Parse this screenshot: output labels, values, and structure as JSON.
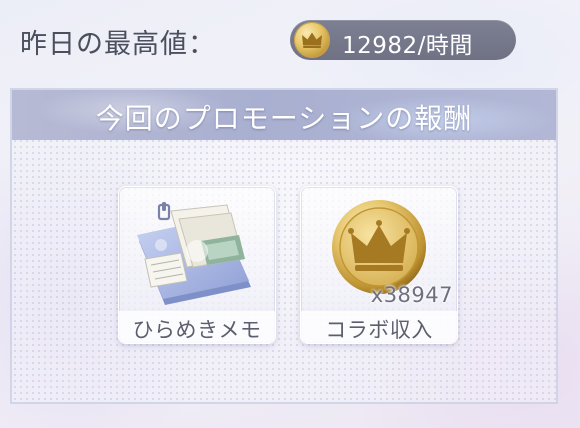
{
  "top": {
    "label": "昨日の最高値：",
    "rate": "12982/時間",
    "rate_icon": "crown-coin-icon"
  },
  "panel": {
    "title": "今回のプロモーションの報酬"
  },
  "rewards": [
    {
      "label": "ひらめきメモ",
      "icon": "memo-bundle-icon"
    },
    {
      "label": "コラボ収入",
      "quantity": "x38947",
      "icon": "crown-coin-icon"
    }
  ],
  "colors": {
    "pill": "#74778a",
    "header": "#afb4d3",
    "coin_gold": "#e4c269",
    "label_text": "#5b5e6e"
  }
}
